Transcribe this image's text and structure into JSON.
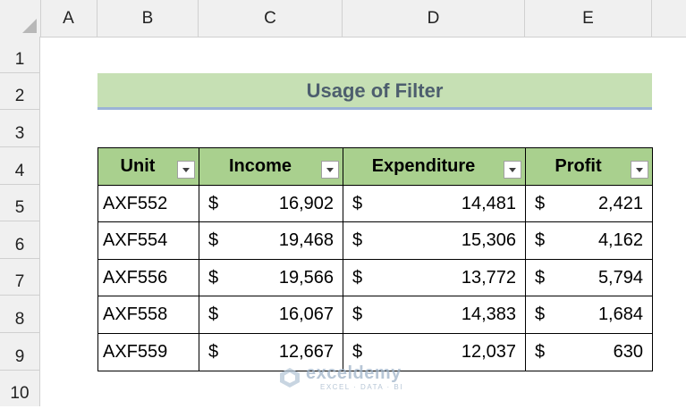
{
  "columns": [
    "A",
    "B",
    "C",
    "D",
    "E"
  ],
  "rows": [
    "1",
    "2",
    "3",
    "4",
    "5",
    "6",
    "7",
    "8",
    "9",
    "10"
  ],
  "title": "Usage of Filter",
  "table": {
    "headers": [
      "Unit",
      "Income",
      "Expenditure",
      "Profit"
    ],
    "currency_symbol": "$",
    "records": [
      {
        "unit": "AXF552",
        "income": "16,902",
        "expenditure": "14,481",
        "profit": "2,421"
      },
      {
        "unit": "AXF554",
        "income": "19,468",
        "expenditure": "15,306",
        "profit": "4,162"
      },
      {
        "unit": "AXF556",
        "income": "19,566",
        "expenditure": "13,772",
        "profit": "5,794"
      },
      {
        "unit": "AXF558",
        "income": "16,067",
        "expenditure": "14,383",
        "profit": "1,684"
      },
      {
        "unit": "AXF559",
        "income": "12,667",
        "expenditure": "12,037",
        "profit": "630"
      }
    ]
  },
  "watermark": {
    "name": "exceldemy",
    "tagline": "EXCEL · DATA · BI"
  },
  "colors": {
    "header_fill": "#a9d08e",
    "title_fill": "#c6e0b4",
    "title_text": "#4d5e6e"
  }
}
